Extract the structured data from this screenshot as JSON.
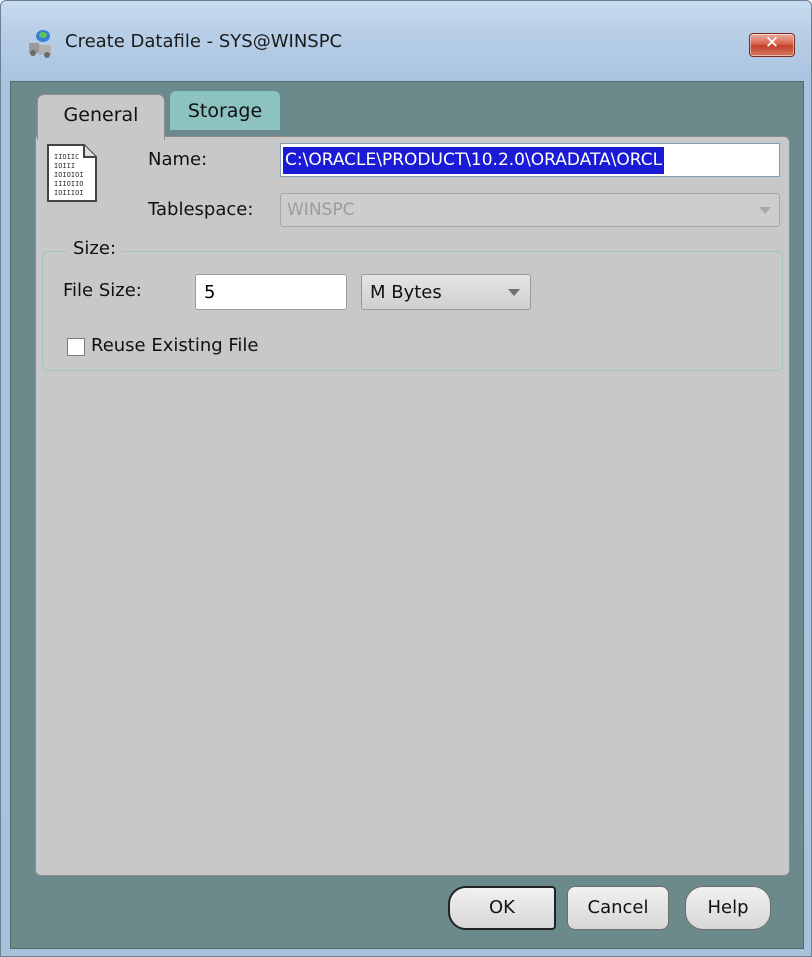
{
  "window": {
    "title": "Create Datafile - SYS@WINSPC",
    "close_label": "✕"
  },
  "tabs": [
    {
      "label": "General",
      "active": true
    },
    {
      "label": "Storage",
      "active": false
    }
  ],
  "general": {
    "name_label": "Name:",
    "name_value": "C:\\ORACLE\\PRODUCT\\10.2.0\\ORADATA\\ORCL",
    "tablespace_label": "Tablespace:",
    "tablespace_value": "WINSPC",
    "size_group_label": "Size:",
    "file_size_label": "File Size:",
    "file_size_value": "5",
    "unit_value": "M Bytes",
    "reuse_label": "Reuse Existing File",
    "reuse_checked": false
  },
  "buttons": {
    "ok": "OK",
    "cancel": "Cancel",
    "help": "Help"
  }
}
